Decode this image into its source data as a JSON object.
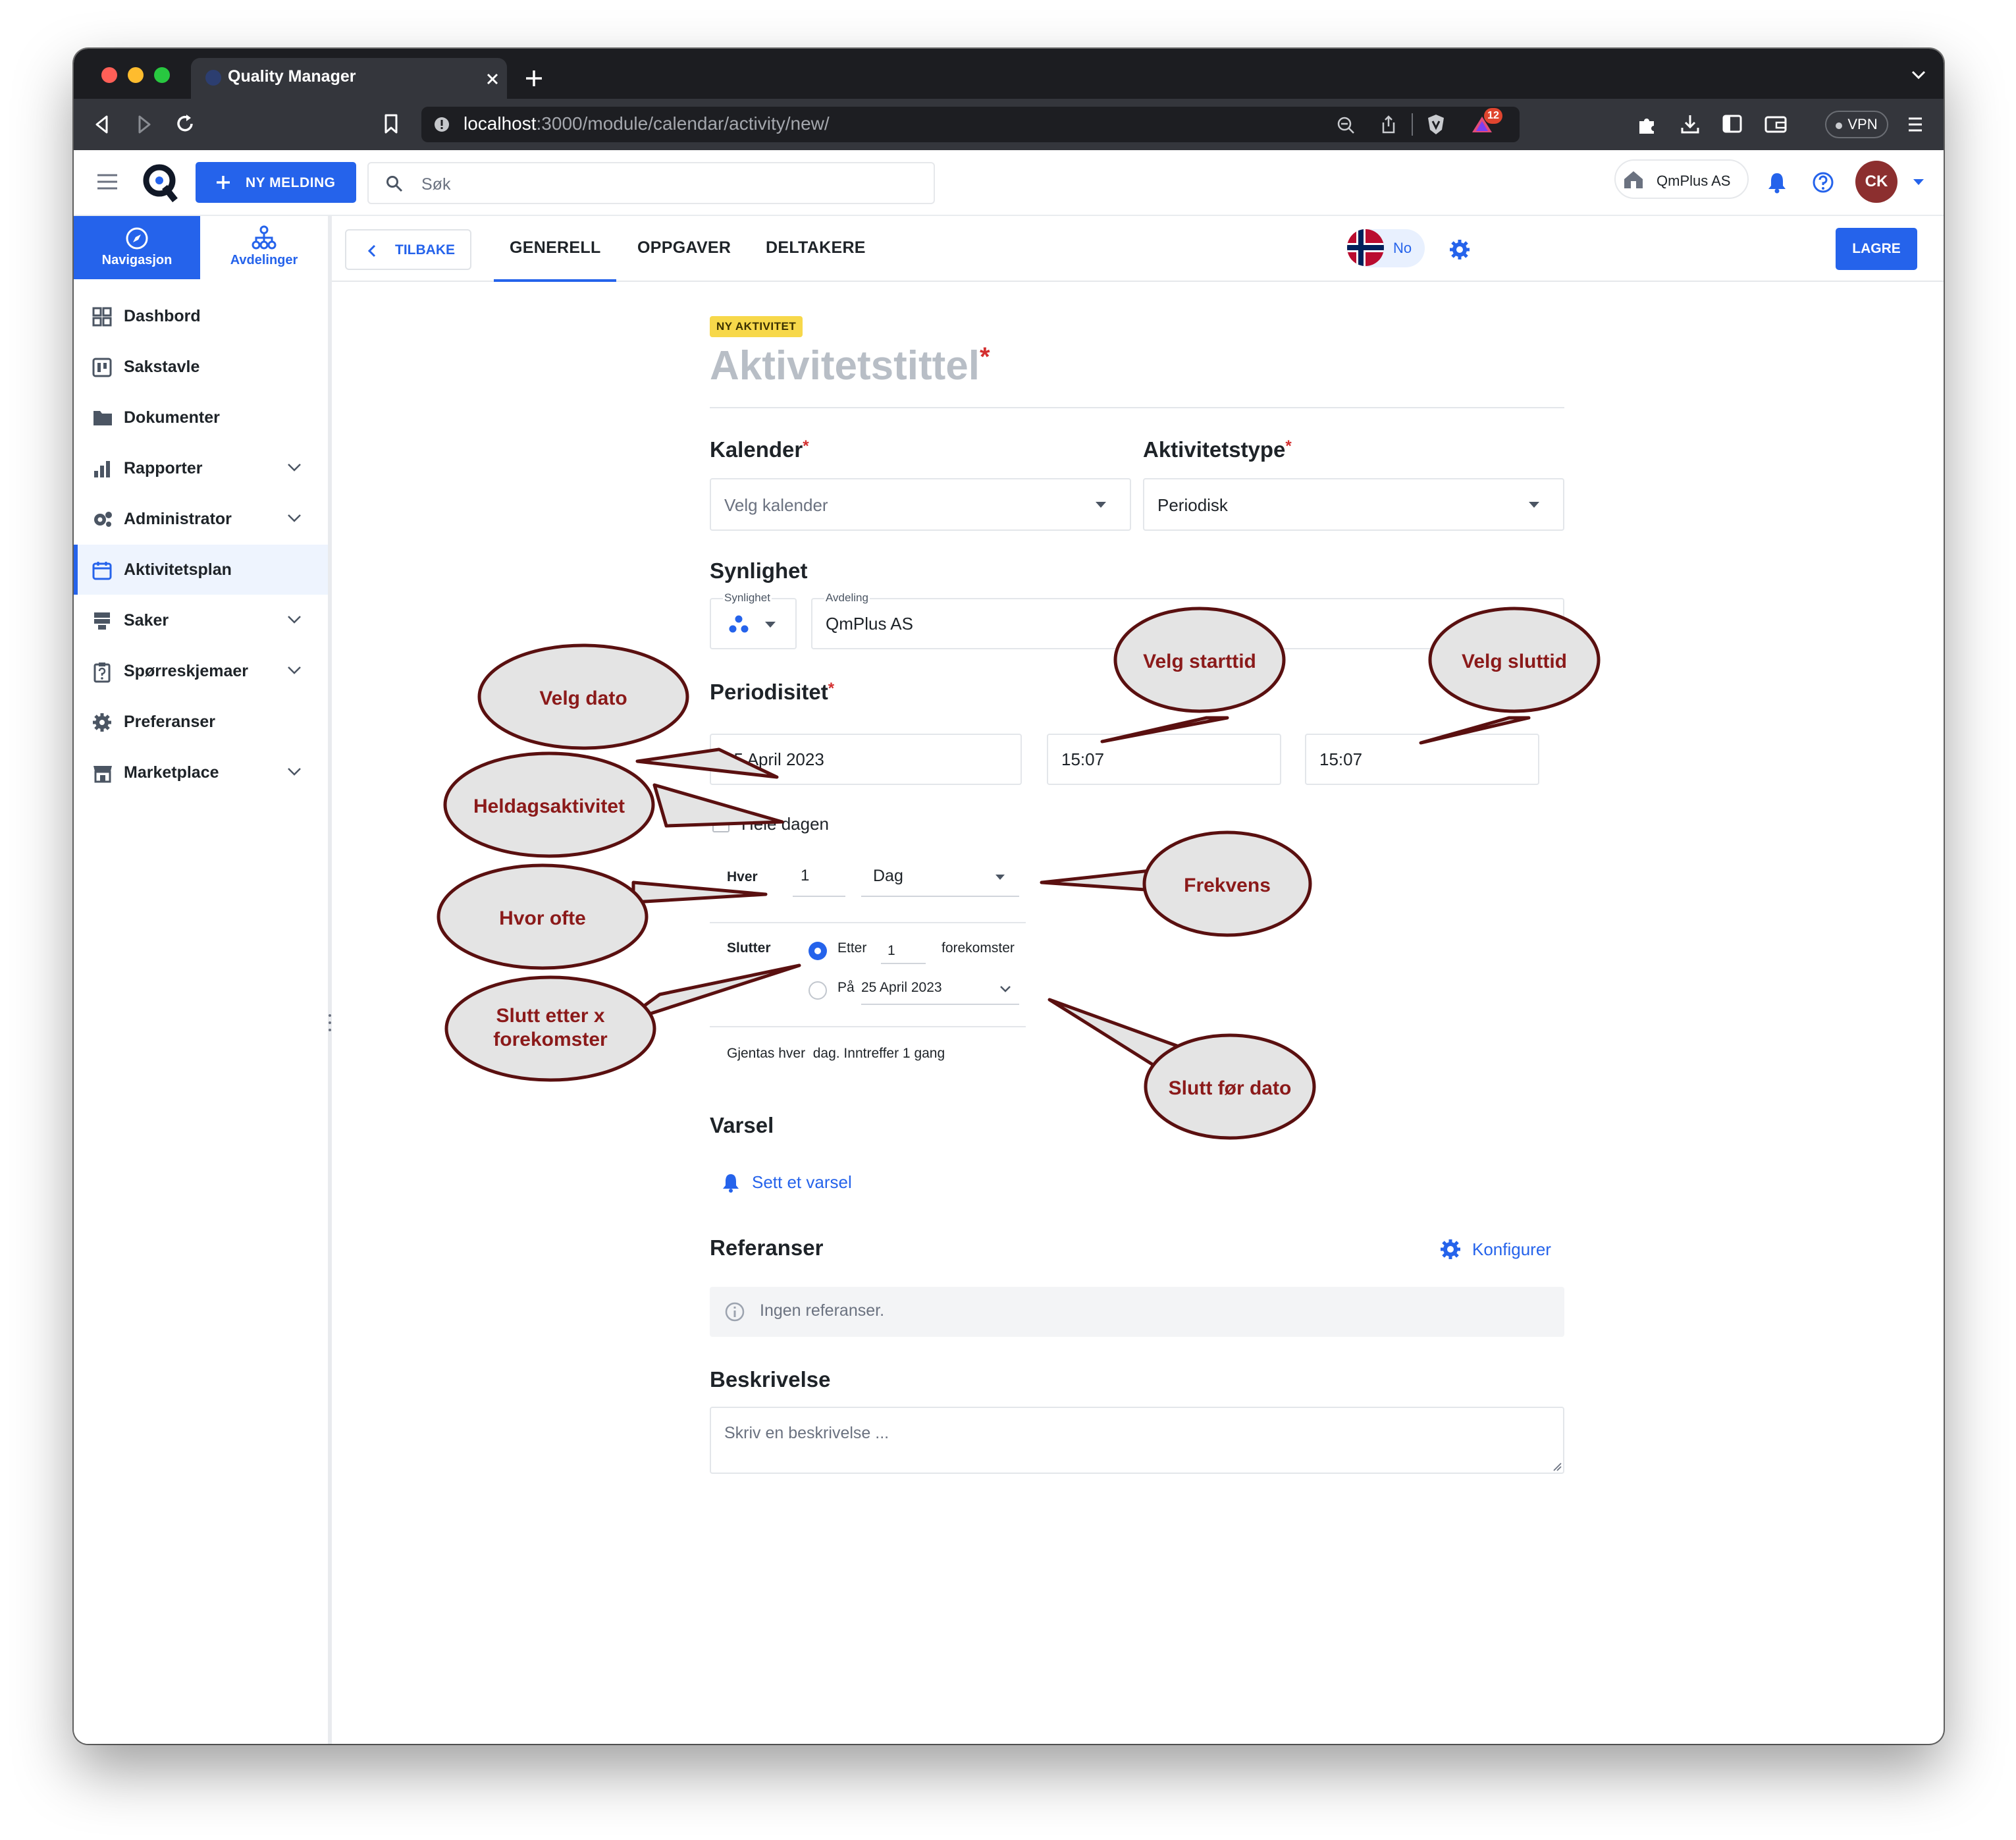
{
  "browser": {
    "tab_title": "Quality Manager",
    "url_host": "localhost",
    "url_path": ":3000/module/calendar/activity/new/",
    "badge_count": "12",
    "vpn_label": "VPN"
  },
  "header": {
    "new_message": "NY MELDING",
    "search_placeholder": "Søk",
    "company": "QmPlus AS",
    "avatar_initials": "CK"
  },
  "sidebar": {
    "tab_nav": "Navigasjon",
    "tab_dep": "Avdelinger",
    "items": [
      {
        "label": "Dashbord"
      },
      {
        "label": "Sakstavle"
      },
      {
        "label": "Dokumenter"
      },
      {
        "label": "Rapporter"
      },
      {
        "label": "Administrator"
      },
      {
        "label": "Aktivitetsplan"
      },
      {
        "label": "Saker"
      },
      {
        "label": "Spørreskjemaer"
      },
      {
        "label": "Preferanser"
      },
      {
        "label": "Marketplace"
      }
    ]
  },
  "subheader": {
    "back": "TILBAKE",
    "tabs": [
      "GENERELL",
      "OPPGAVER",
      "DELTAKERE"
    ],
    "lang": "No",
    "save": "LAGRE"
  },
  "form": {
    "badge": "NY AKTIVITET",
    "title_placeholder": "Aktivitetstittel",
    "req_mark": "*",
    "calendar_label": "Kalender",
    "calendar_placeholder": "Velg kalender",
    "type_label": "Aktivitetstype",
    "type_value": "Periodisk",
    "visibility_heading": "Synlighet",
    "visibility_small_label": "Synlighet",
    "department_small_label": "Avdeling",
    "department_value": "QmPlus AS",
    "periodicity_heading": "Periodisitet",
    "date_value": "25 April 2023",
    "start_time": "15:07",
    "end_time": "15:07",
    "all_day_label": "Hele dagen",
    "every_label": "Hver",
    "every_value": "1",
    "freq_value": "Dag",
    "ends_label": "Slutter",
    "after_label": "Etter",
    "after_value": "1",
    "occurrences_label": "forekomster",
    "on_label": "På",
    "on_date": "25 April 2023",
    "summary": "Gjentas hver  dag. Inntreffer 1 gang",
    "alert_heading": "Varsel",
    "alert_link": "Sett et varsel",
    "refs_heading": "Referanser",
    "configure": "Konfigurer",
    "no_refs": "Ingen referanser.",
    "desc_heading": "Beskrivelse",
    "desc_placeholder": "Skriv en beskrivelse ..."
  },
  "callouts": {
    "velg_dato": "Velg dato",
    "velg_starttid": "Velg starttid",
    "velg_sluttid": "Velg sluttid",
    "heldag": "Heldagsaktivitet",
    "hvor_ofte": "Hvor ofte",
    "frekvens": "Frekvens",
    "slutt_etter_1": "Slutt etter x",
    "slutt_etter_2": "forekomster",
    "slutt_for_dato": "Slutt før dato"
  },
  "colors": {
    "accent": "#2563eb",
    "badge_bg": "#f7d84a",
    "callout_fill": "#e4e4e4",
    "callout_stroke": "#5a1010",
    "callout_text": "#8b1a1a",
    "required": "#d32f2f"
  }
}
